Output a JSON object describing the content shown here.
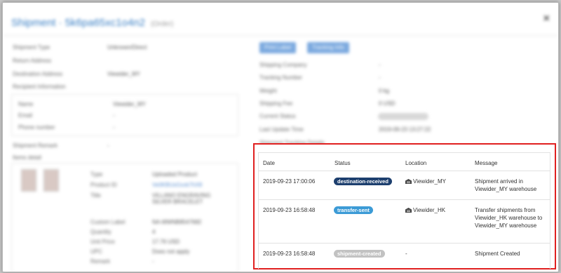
{
  "modal": {
    "title": "Shipment",
    "title_id": "5k6pa65xc1o4n2",
    "title_sub": "(Order)",
    "close_glyph": "×"
  },
  "left": {
    "fields": [
      {
        "label": "Shipment Type",
        "value": "Unknown/Direct"
      },
      {
        "label": "Return Address",
        "value": ""
      },
      {
        "label": "Destination Address",
        "value": "Viewider_MY"
      },
      {
        "label": "Recipient Information",
        "value": ""
      }
    ],
    "recipient": [
      {
        "label": "Name",
        "value": "Viewider_MY"
      },
      {
        "label": "Email",
        "value": "-"
      },
      {
        "label": "Phone number",
        "value": "-"
      }
    ],
    "shipment_remark_label": "Shipment Remark",
    "shipment_remark_value": "-",
    "items_label": "Items detail",
    "item": [
      {
        "label": "Type",
        "value": "Uploaded Product"
      },
      {
        "label": "Product ID",
        "value": "Ve0KBUsGxxk7hX8"
      },
      {
        "label": "Title",
        "value": "VILLANO ENGRAVING SILVER BRACELET"
      },
      {
        "label": "Custom Label",
        "value": "NA-MWNB8547682"
      },
      {
        "label": "Quantity",
        "value": "4"
      },
      {
        "label": "Unit Price",
        "value": "17.76 USD"
      },
      {
        "label": "UPC",
        "value": "Does not apply"
      },
      {
        "label": "Remark",
        "value": "-"
      }
    ]
  },
  "right": {
    "buttons": [
      "Print Label",
      "Tracking Info"
    ],
    "fields": [
      {
        "label": "Shipping Company",
        "value": "-"
      },
      {
        "label": "Tracking Number",
        "value": "-"
      },
      {
        "label": "Weight",
        "value": "0 kg"
      },
      {
        "label": "Shipping Fee",
        "value": "0 USD"
      },
      {
        "label": "Current Status",
        "value": ""
      },
      {
        "label": "Last Update Time",
        "value": "2019-09-23 13:27:22"
      }
    ],
    "tracking_label": "Shipment Tracking Details"
  },
  "tracking": {
    "headers": [
      "Date",
      "Status",
      "Location",
      "Message"
    ],
    "rows": [
      {
        "date": "2019-09-23 17:00:06",
        "status": "destination-received",
        "status_color": "#1d3f6e",
        "location": "Viewider_MY",
        "message": "Shipment arrived in Viewider_MY warehouse"
      },
      {
        "date": "2019-09-23 16:58:48",
        "status": "transfer-sent",
        "status_color": "#3c9bd6",
        "location": "Viewider_HK",
        "message": "Transfer shipments from Viewider_HK warehouse to Viewider_MY warehouse"
      },
      {
        "date": "2019-09-23 16:58:48",
        "status": "shipment-created",
        "status_color": "#c2c2c2",
        "location": "-",
        "message": "Shipment Created"
      }
    ]
  },
  "colors": {
    "highlight": "#e02020",
    "accent": "#3a7fc4",
    "button": "#7ba9df"
  },
  "icons": {
    "warehouse": "warehouse-icon",
    "close": "close-icon"
  }
}
